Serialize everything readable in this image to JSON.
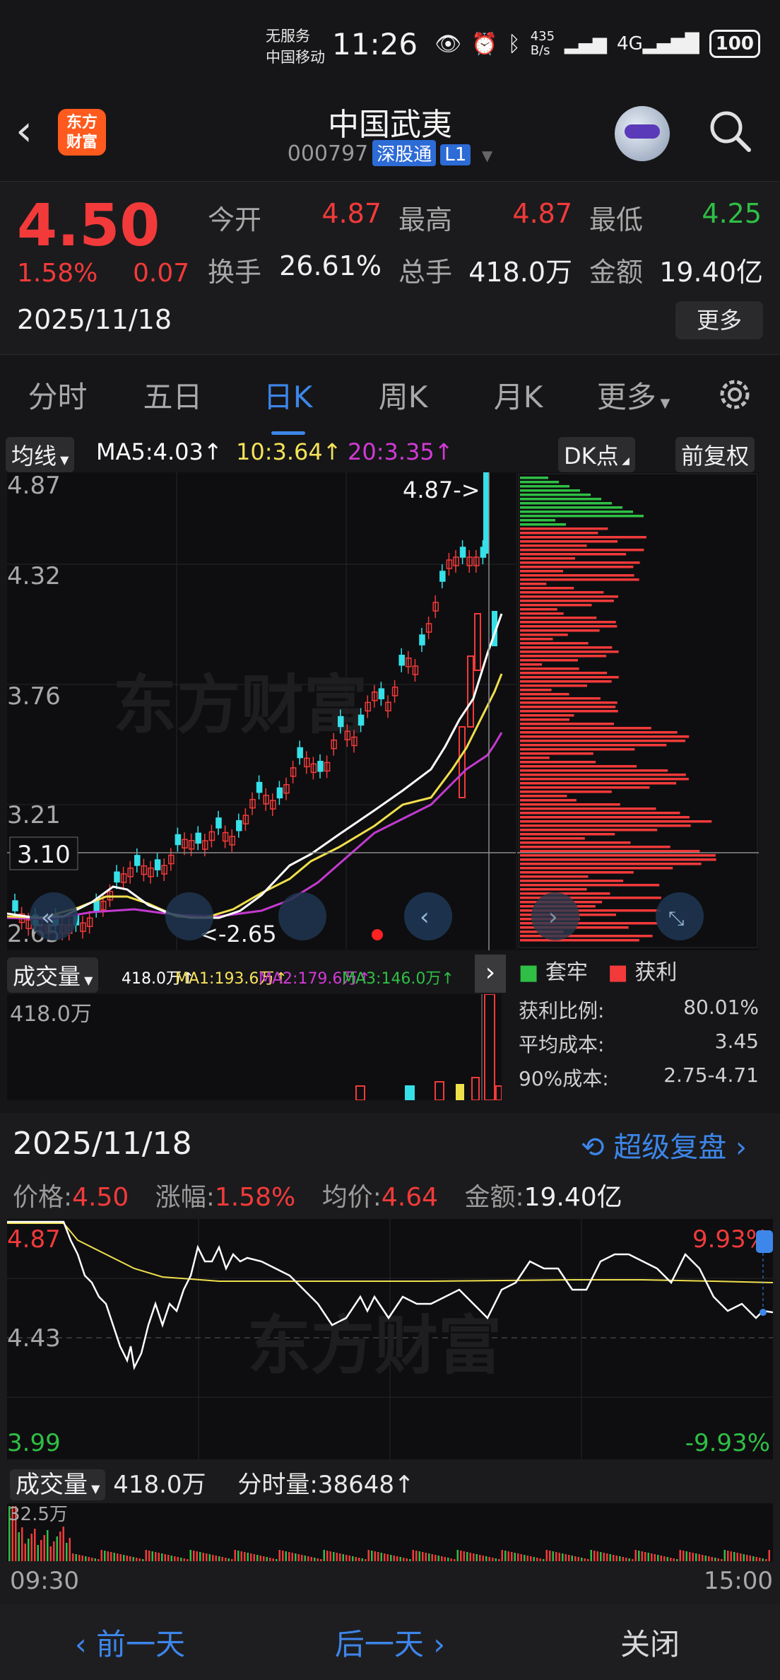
{
  "status": {
    "carrier_line1": "无服务",
    "carrier_line2": "中国移动",
    "time": "11:26",
    "netspeed": "435\nB/s",
    "battery": "100"
  },
  "header": {
    "logo_text": "东方\n财富",
    "title": "中国武夷",
    "code": "000797",
    "tag1": "深股通",
    "tag2": "L1"
  },
  "quote": {
    "price": "4.50",
    "pct": "1.58%",
    "change": "0.07",
    "date": "2025/11/18",
    "open_label": "今开",
    "open": "4.87",
    "high_label": "最高",
    "high": "4.87",
    "low_label": "最低",
    "low": "4.25",
    "turnover_label": "换手",
    "turnover": "26.61%",
    "volume_label": "总手",
    "volume": "418.0万",
    "amount_label": "金额",
    "amount": "19.40亿",
    "more": "更多"
  },
  "tabs": [
    "分时",
    "五日",
    "日K",
    "周K",
    "月K",
    "更多"
  ],
  "active_tab": "日K",
  "ma": {
    "selector": "均线",
    "ma5": "MA5:4.03",
    "ma10": "10:3.64",
    "ma20": "20:3.35",
    "dk": "DK点",
    "adjust": "前复权"
  },
  "kline": {
    "y_labels": [
      "4.87",
      "4.32",
      "3.76",
      "3.21",
      "2.65"
    ],
    "crosshair_value": "3.10",
    "high_marker": "4.87->",
    "low_marker": "<-2.65",
    "watermark": "东方财富"
  },
  "chip": {
    "legend_trapped": "套牢",
    "legend_profit": "获利",
    "stats": [
      {
        "label": "获利比例:",
        "value": "80.01%"
      },
      {
        "label": "平均成本:",
        "value": "3.45"
      },
      {
        "label": "90%成本:",
        "value": "2.75-4.71"
      }
    ]
  },
  "volume": {
    "selector": "成交量",
    "vol": "418.0万",
    "ma1": "MA1:193.6万",
    "ma2": "MA2:179.6万",
    "ma3": "MA3:146.0万",
    "axis_max": "418.0万"
  },
  "intraday": {
    "date": "2025/11/18",
    "replay": "超级复盘",
    "price_label": "价格:",
    "price": "4.50",
    "pct_label": "涨幅:",
    "pct": "1.58%",
    "avg_label": "均价:",
    "avg": "4.64",
    "amount_label": "金额:",
    "amount": "19.40亿",
    "y_top": "4.87",
    "y_mid": "4.43",
    "y_bot": "3.99",
    "pct_top": "9.93%",
    "pct_bot": "-9.93%",
    "vol_selector": "成交量",
    "vol": "418.0万",
    "minute_vol": "分时量:38648",
    "vol_axis": "32.5万",
    "time_start": "09:30",
    "time_end": "15:00"
  },
  "colors": {
    "up": "#f23a3a",
    "down": "#2fbf45",
    "accent": "#3d86ea",
    "ma5": "#ffffff",
    "ma10": "#f5e25a",
    "ma20": "#d23ad6"
  },
  "bottom_nav": {
    "prev": "前一天",
    "next": "后一天",
    "close": "关闭"
  }
}
